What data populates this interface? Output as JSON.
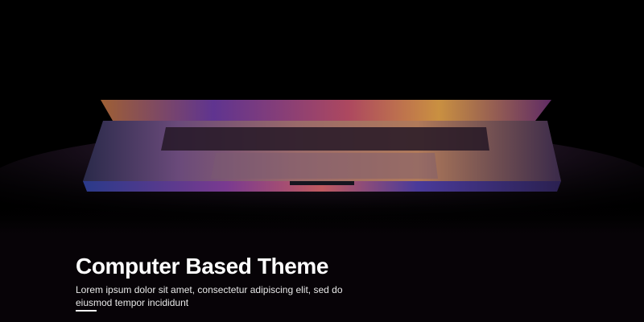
{
  "slide": {
    "title": "Computer Based Theme",
    "description": "Lorem ipsum dolor sit amet, consectetur adipiscing elit, sed do eiusmod tempor incididunt"
  },
  "photo": {
    "subject": "laptop-icon",
    "glow_colors": [
      "#e8893a",
      "#b24a8c",
      "#3a4fb0",
      "#7a3ad0"
    ]
  },
  "colors": {
    "background": "#000000",
    "footer_background": "#070307",
    "text": "#ffffff"
  }
}
